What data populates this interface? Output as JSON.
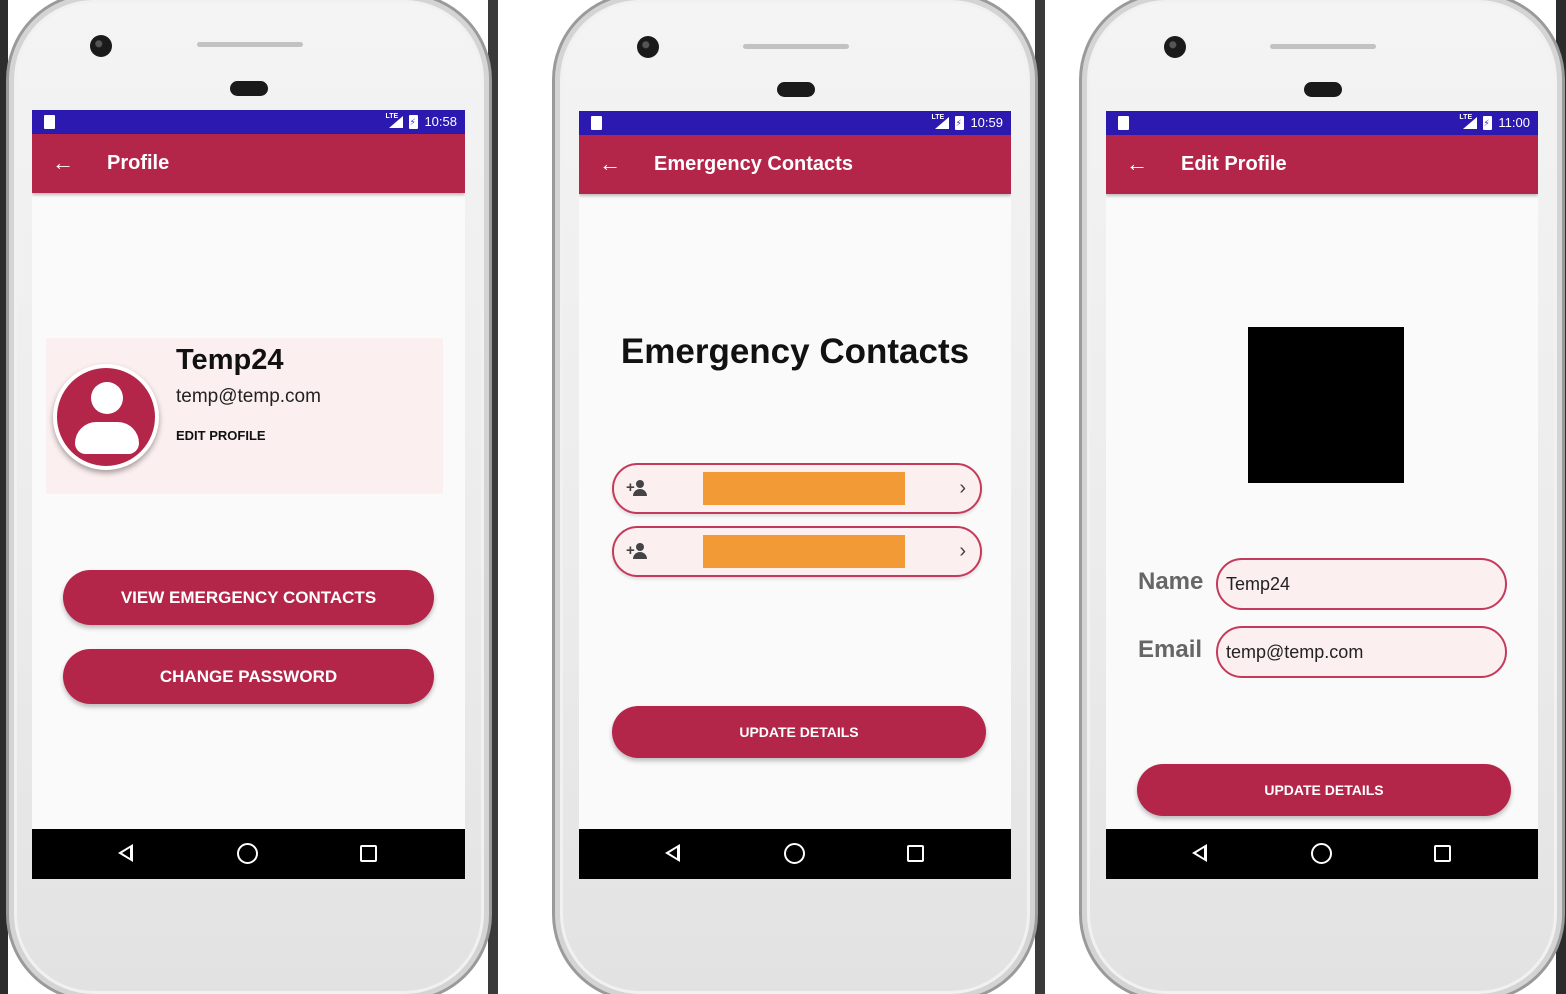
{
  "screens": [
    {
      "status": {
        "time": "10:58",
        "network": "LTE"
      },
      "appbar": {
        "title": "Profile"
      },
      "profile": {
        "name": "Temp24",
        "email": "temp@temp.com",
        "edit_label": "EDIT PROFILE"
      },
      "buttons": {
        "view_contacts": "VIEW EMERGENCY CONTACTS",
        "change_password": "CHANGE PASSWORD"
      }
    },
    {
      "status": {
        "time": "10:59",
        "network": "LTE"
      },
      "appbar": {
        "title": "Emergency Contacts"
      },
      "heading": "Emergency Contacts",
      "contacts": [
        {
          "icon": "add-person-icon",
          "value": ""
        },
        {
          "icon": "add-person-icon",
          "value": ""
        }
      ],
      "buttons": {
        "update": "UPDATE DETAILS"
      }
    },
    {
      "status": {
        "time": "11:00",
        "network": "LTE"
      },
      "appbar": {
        "title": "Edit Profile"
      },
      "form": {
        "name_label": "Name",
        "name_value": "Temp24",
        "email_label": "Email",
        "email_value": "temp@temp.com"
      },
      "buttons": {
        "update": "UPDATE DETAILS"
      }
    }
  ],
  "colors": {
    "primary": "#b3264a",
    "status_bar": "#2c1ab0",
    "card_bg": "#fcefef",
    "redaction": "#f19a36"
  }
}
